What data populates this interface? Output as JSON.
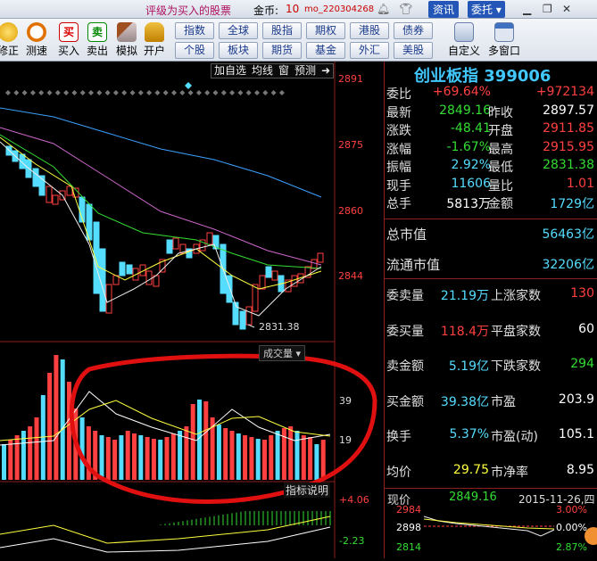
{
  "topbar": {
    "news": "评级为买入的股票",
    "coin_label": "金币:",
    "coin_value": "10",
    "user": "mo_220304268",
    "btn_info": "资讯",
    "btn_trade": "委托"
  },
  "toolbar": {
    "left_buttons": [
      {
        "label": "修正",
        "icon": "refresh-icon"
      },
      {
        "label": "测速",
        "icon": "clock-icon"
      },
      {
        "label": "买入",
        "icon": "buy-icon"
      },
      {
        "label": "卖出",
        "icon": "sell-icon"
      },
      {
        "label": "模拟",
        "icon": "hammer-icon"
      },
      {
        "label": "开户",
        "icon": "lock-icon"
      }
    ],
    "nav_row1": [
      "指数",
      "全球",
      "股指",
      "期权",
      "港股",
      "债券"
    ],
    "nav_row2": [
      "个股",
      "板块",
      "期货",
      "基金",
      "外汇",
      "美股"
    ],
    "right_buttons": [
      {
        "label": "自定义",
        "icon": "custom-icon"
      },
      {
        "label": "多窗口",
        "icon": "window-icon"
      }
    ]
  },
  "chart": {
    "tabs": [
      "加自选",
      "均线",
      "窗",
      "预测"
    ],
    "price_axis": [
      "2891",
      "2875",
      "2860",
      "2844"
    ],
    "low_label": "2831.38",
    "vol_axis": [
      "39",
      "19"
    ],
    "vol_menu": "成交量",
    "ind_button": "指标说明",
    "macd_axis": [
      "+4.06",
      "-2.23"
    ]
  },
  "quote": {
    "title": "创业板指 399006",
    "rows1": [
      {
        "l1": "委比",
        "v1": "+69.64%",
        "c1": "red",
        "l2": "",
        "v2": "+972134",
        "c2": "red"
      },
      {
        "l1": "最新",
        "v1": "2849.16",
        "c1": "grn",
        "l2": "昨收",
        "v2": "2897.57",
        "c2": "wht"
      },
      {
        "l1": "涨跌",
        "v1": "-48.41",
        "c1": "grn",
        "l2": "开盘",
        "v2": "2911.85",
        "c2": "red"
      },
      {
        "l1": "涨幅",
        "v1": "-1.67%",
        "c1": "grn",
        "l2": "最高",
        "v2": "2915.95",
        "c2": "red"
      },
      {
        "l1": "振幅",
        "v1": "2.92%",
        "c1": "cyan",
        "l2": "最低",
        "v2": "2831.38",
        "c2": "grn"
      },
      {
        "l1": "现手",
        "v1": "11606",
        "c1": "cyan",
        "l2": "量比",
        "v2": "1.01",
        "c2": "red"
      },
      {
        "l1": "总手",
        "v1": "5813万",
        "c1": "wht",
        "l2": "金额",
        "v2": "1729亿",
        "c2": "cyan"
      }
    ],
    "market_cap": {
      "label": "总市值",
      "value": "56463亿"
    },
    "float_cap": {
      "label": "流通市值",
      "value": "32206亿"
    },
    "rows2": [
      {
        "l1": "委卖量",
        "v1": "21.19万",
        "c1": "cyan",
        "l2": "上涨家数",
        "v2": "130",
        "c2": "red"
      },
      {
        "l1": "委买量",
        "v1": "118.4万",
        "c1": "red",
        "l2": "平盘家数",
        "v2": "60",
        "c2": "wht"
      },
      {
        "l1": "卖金额",
        "v1": "5.19亿",
        "c1": "cyan",
        "l2": "下跌家数",
        "v2": "294",
        "c2": "grn"
      },
      {
        "l1": "买金额",
        "v1": "39.38亿",
        "c1": "cyan",
        "l2": "市盈",
        "v2": "203.9",
        "c2": "wht"
      },
      {
        "l1": "换手",
        "v1": "5.37%",
        "c1": "cyan",
        "l2": "市盈(动)",
        "v2": "105.1",
        "c2": "wht"
      },
      {
        "l1": "均价",
        "v1": "29.75",
        "c1": "yel",
        "l2": "市净率",
        "v2": "8.95",
        "c2": "wht"
      }
    ],
    "mini": {
      "label": "现价",
      "price": "2849.16",
      "date": "2015-11-26,四",
      "axis_left": [
        "2984",
        "2898",
        "2814"
      ],
      "axis_right": [
        "3.00%",
        "0.00%",
        "2.87%"
      ]
    }
  },
  "colors": {
    "up": "#ff4040",
    "down": "#55ddff",
    "annotation": "#e01010"
  }
}
